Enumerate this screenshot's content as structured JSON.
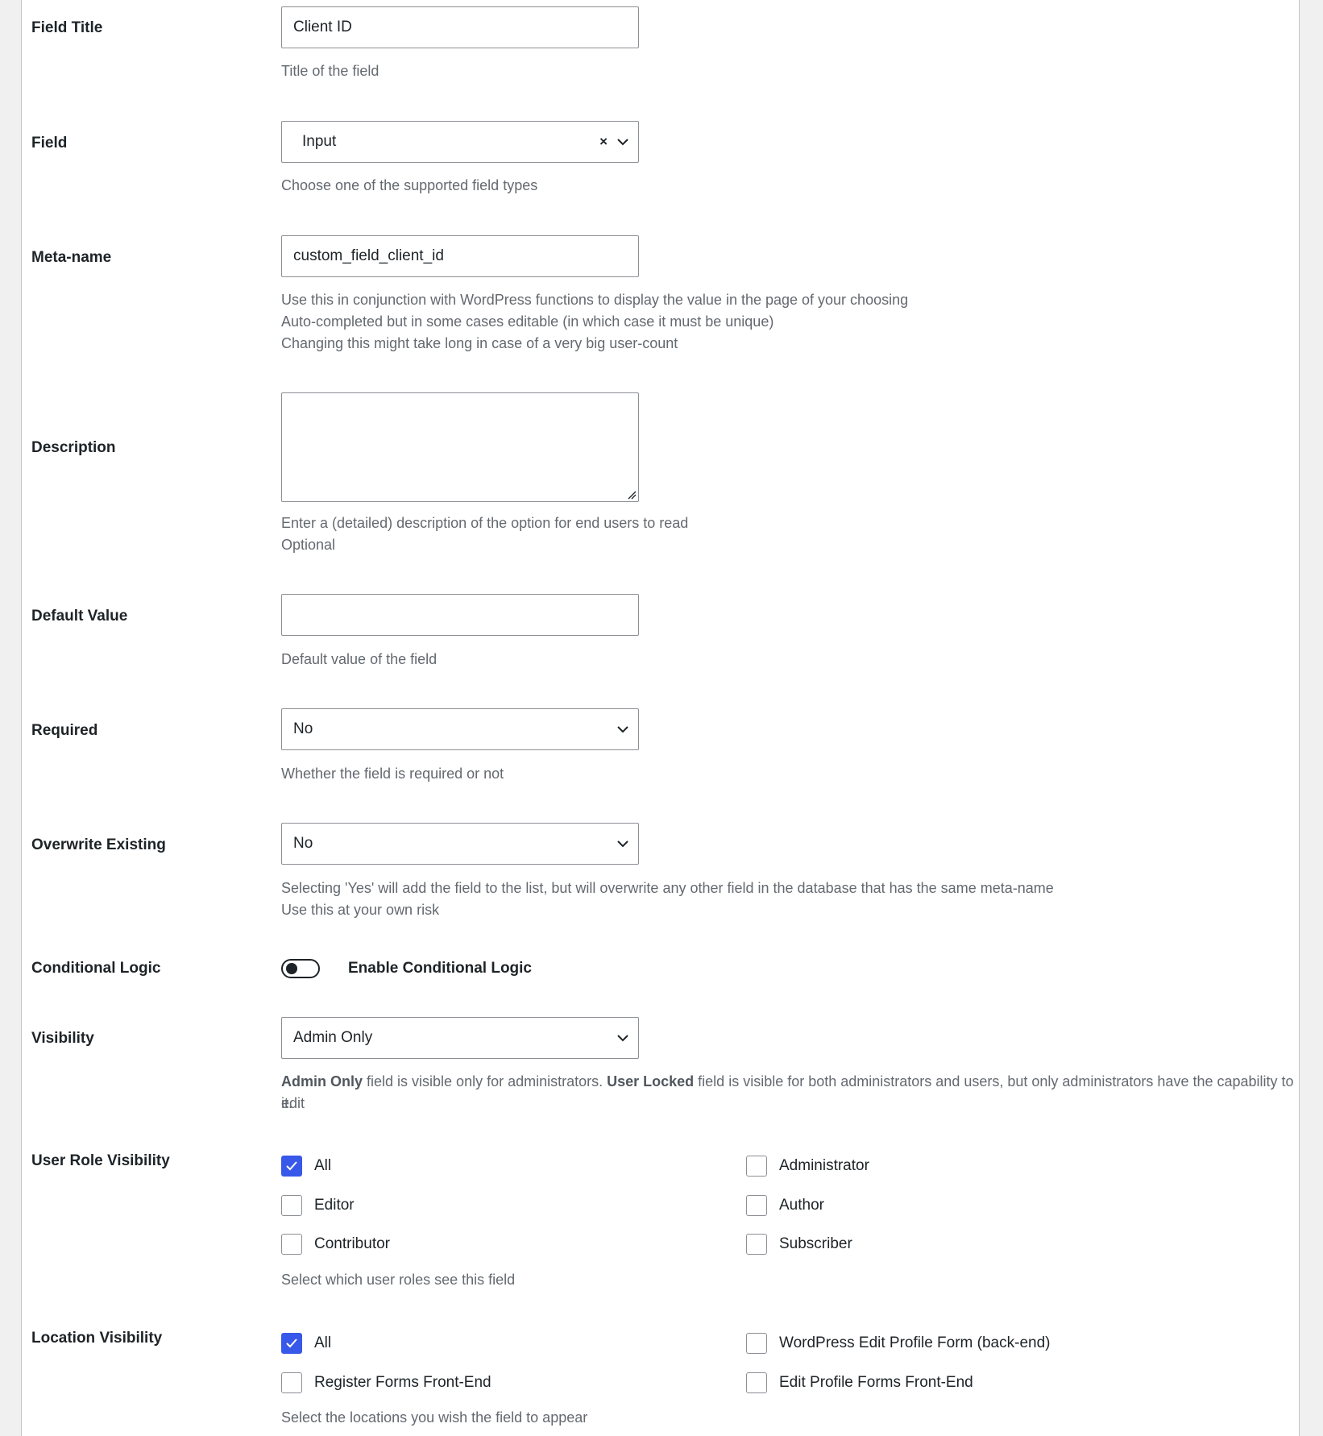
{
  "fields": {
    "field_title": {
      "label": "Field Title",
      "value": "Client ID",
      "help": "Title of the field"
    },
    "field": {
      "label": "Field",
      "value": "Input",
      "clear": "×",
      "help": "Choose one of the supported field types"
    },
    "meta_name": {
      "label": "Meta-name",
      "value": "custom_field_client_id",
      "help": [
        "Use this in conjunction with WordPress functions to display the value in the page of your choosing",
        "Auto-completed but in some cases editable (in which case it must be unique)",
        "Changing this might take long in case of a very big user-count"
      ]
    },
    "description": {
      "label": "Description",
      "value": "",
      "help": [
        "Enter a (detailed) description of the option for end users to read",
        "Optional"
      ]
    },
    "default_value": {
      "label": "Default Value",
      "value": "",
      "help": "Default value of the field"
    },
    "required": {
      "label": "Required",
      "value": "No",
      "help": "Whether the field is required or not"
    },
    "overwrite_existing": {
      "label": "Overwrite Existing",
      "value": "No",
      "help": [
        "Selecting 'Yes' will add the field to the list, but will overwrite any other field in the database that has the same meta-name",
        "Use this at your own risk"
      ]
    },
    "conditional_logic": {
      "label": "Conditional Logic",
      "toggle_label": "Enable Conditional Logic",
      "enabled": false
    },
    "visibility": {
      "label": "Visibility",
      "value": "Admin Only",
      "help": {
        "admin_only_strong": "Admin Only",
        "admin_only_text": " field is visible only for administrators. ",
        "user_locked_strong": "User Locked",
        "user_locked_text": " field is visible for both administrators and users, but only administrators have the capability to edit",
        "tail": "it."
      }
    },
    "user_role_visibility": {
      "label": "User Role Visibility",
      "options": [
        {
          "label": "All",
          "checked": true
        },
        {
          "label": "Administrator",
          "checked": false
        },
        {
          "label": "Editor",
          "checked": false
        },
        {
          "label": "Author",
          "checked": false
        },
        {
          "label": "Contributor",
          "checked": false
        },
        {
          "label": "Subscriber",
          "checked": false
        }
      ],
      "help": "Select which user roles see this field"
    },
    "location_visibility": {
      "label": "Location Visibility",
      "options": [
        {
          "label": "All",
          "checked": true
        },
        {
          "label": "WordPress Edit Profile Form (back-end)",
          "checked": false
        },
        {
          "label": "Register Forms Front-End",
          "checked": false
        },
        {
          "label": "Edit Profile Forms Front-End",
          "checked": false
        }
      ],
      "help": "Select the locations you wish the field to appear"
    }
  },
  "colors": {
    "accent": "#3858e9",
    "help_text": "#646970",
    "border": "#8c8f94"
  }
}
